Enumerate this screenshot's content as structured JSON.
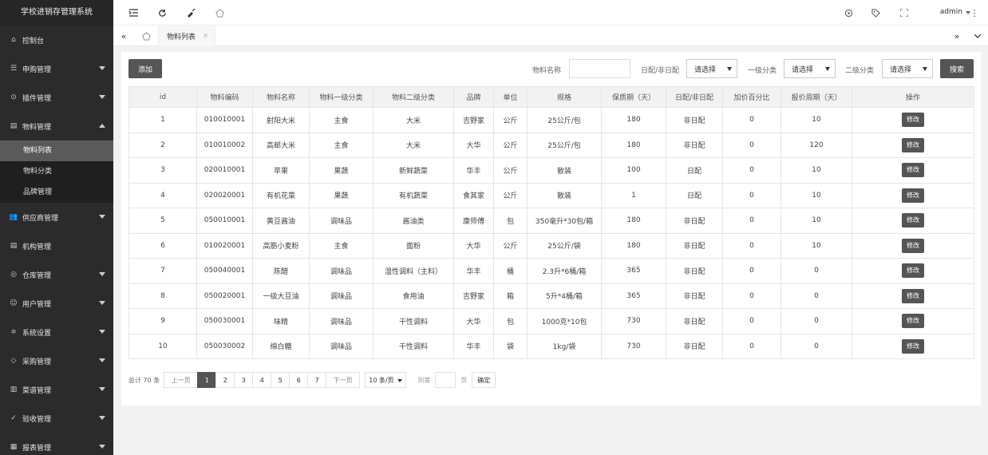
{
  "app": {
    "title": "学校进销存管理系统"
  },
  "sidebar": {
    "items": [
      {
        "label": "控制台",
        "icon": "home-icon",
        "expandable": false
      },
      {
        "label": "申购管理",
        "icon": "list-icon",
        "expandable": true
      },
      {
        "label": "插件管理",
        "icon": "plugin-icon",
        "expandable": true
      },
      {
        "label": "物料管理",
        "icon": "doc-icon",
        "expandable": true,
        "expanded": true,
        "children": [
          {
            "label": "物料列表",
            "active": true
          },
          {
            "label": "物料分类"
          },
          {
            "label": "品牌管理"
          }
        ]
      },
      {
        "label": "供应商管理",
        "icon": "users-icon",
        "expandable": true
      },
      {
        "label": "机构管理",
        "icon": "doc-icon",
        "expandable": false
      },
      {
        "label": "仓库管理",
        "icon": "location-icon",
        "expandable": true
      },
      {
        "label": "用户管理",
        "icon": "user-icon",
        "expandable": true
      },
      {
        "label": "系统设置",
        "icon": "settings-icon",
        "expandable": true
      },
      {
        "label": "采购管理",
        "icon": "tag-icon",
        "expandable": true
      },
      {
        "label": "菜谱管理",
        "icon": "book-icon",
        "expandable": true
      },
      {
        "label": "验收管理",
        "icon": "check-icon",
        "expandable": true
      },
      {
        "label": "报表管理",
        "icon": "chart-icon",
        "expandable": true
      }
    ]
  },
  "header": {
    "user": "admin"
  },
  "tabs": [
    {
      "label": "物料列表"
    }
  ],
  "toolbar": {
    "add_label": "添加",
    "name_label": "物料名称",
    "name_value": "",
    "daily_label": "日配/非日配",
    "daily_value": "请选择",
    "cat1_label": "一级分类",
    "cat1_value": "请选择",
    "cat2_label": "二级分类",
    "cat2_value": "请选择",
    "search_label": "搜索"
  },
  "table": {
    "columns": [
      "id",
      "物料编码",
      "物料名称",
      "物料一级分类",
      "物料二级分类",
      "品牌",
      "单位",
      "规格",
      "保质期（天）",
      "日配/非日配",
      "加价百分比",
      "报价周期（天）",
      "操作"
    ],
    "action_label": "修改",
    "rows": [
      [
        "1",
        "010010001",
        "射阳大米",
        "主食",
        "大米",
        "吉野家",
        "公斤",
        "25公斤/包",
        "180",
        "非日配",
        "0",
        "10"
      ],
      [
        "2",
        "010010002",
        "高邮大米",
        "主食",
        "大米",
        "大华",
        "公斤",
        "25公斤/包",
        "180",
        "非日配",
        "0",
        "120"
      ],
      [
        "3",
        "020010001",
        "苹果",
        "果蔬",
        "新鲜蔬菜",
        "华丰",
        "公斤",
        "散装",
        "100",
        "日配",
        "0",
        "10"
      ],
      [
        "4",
        "020020001",
        "有机花菜",
        "果蔬",
        "有机蔬菜",
        "食其家",
        "公斤",
        "散装",
        "1",
        "日配",
        "0",
        "10"
      ],
      [
        "5",
        "050010001",
        "黄豆酱油",
        "调味品",
        "酱油类",
        "康师傅",
        "包",
        "350毫升*30包/箱",
        "180",
        "非日配",
        "0",
        "10"
      ],
      [
        "6",
        "010020001",
        "高筋小麦粉",
        "主食",
        "面粉",
        "大华",
        "公斤",
        "25公斤/袋",
        "180",
        "非日配",
        "0",
        "10"
      ],
      [
        "7",
        "050040001",
        "陈醋",
        "调味品",
        "湿性调料（主料）",
        "华丰",
        "桶",
        "2.3升*6桶/箱",
        "365",
        "非日配",
        "0",
        "0"
      ],
      [
        "8",
        "050020001",
        "一级大豆油",
        "调味品",
        "食用油",
        "吉野家",
        "箱",
        "5升*4桶/箱",
        "365",
        "非日配",
        "0",
        "0"
      ],
      [
        "9",
        "050030001",
        "味精",
        "调味品",
        "干性调料",
        "大华",
        "包",
        "1000克*10包",
        "730",
        "非日配",
        "0",
        "0"
      ],
      [
        "10",
        "050030002",
        "绵白糖",
        "调味品",
        "干性调料",
        "华丰",
        "袋",
        "1kg/袋",
        "730",
        "非日配",
        "0",
        "0"
      ]
    ]
  },
  "pagination": {
    "total_text": "总计 70 条",
    "prev_label": "上一页",
    "pages": [
      "1",
      "2",
      "3",
      "4",
      "5",
      "6",
      "7"
    ],
    "current": "1",
    "next_label": "下一页",
    "page_size": "10 条/页",
    "goto_label": "到第",
    "page_unit": "页",
    "confirm_label": "确定"
  }
}
